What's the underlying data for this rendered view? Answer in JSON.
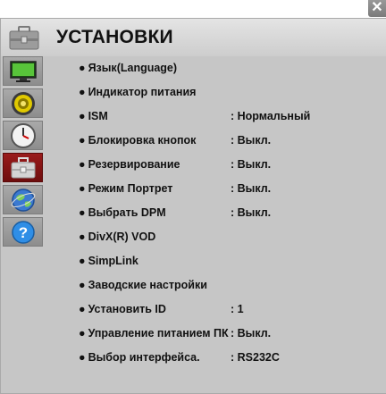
{
  "header": {
    "title": "УСТАНОВКИ",
    "close_label": "✕"
  },
  "bullet": "●",
  "items": [
    {
      "label": "Язык(Language)",
      "value": ""
    },
    {
      "label": "Индикатор питания",
      "value": ""
    },
    {
      "label": "ISM",
      "value": ": Нормальный"
    },
    {
      "label": "Блокировка кнопок",
      "value": ": Выкл."
    },
    {
      "label": "Резервирование",
      "value": ": Выкл."
    },
    {
      "label": "Режим Портрет",
      "value": ": Выкл."
    },
    {
      "label": "Выбрать DPM",
      "value": ": Выкл."
    },
    {
      "label": "DivX(R) VOD",
      "value": ""
    },
    {
      "label": "SimpLink",
      "value": ""
    },
    {
      "label": "Заводские настройки",
      "value": ""
    },
    {
      "label": "Установить ID",
      "value": ": 1"
    },
    {
      "label": "Управление питанием ПК",
      "value": ": Выкл."
    },
    {
      "label": "Выбор интерфейса.",
      "value": ": RS232C"
    }
  ],
  "sidebar": [
    "picture-icon",
    "audio-icon",
    "clock-icon",
    "settings-toolbox-icon",
    "network-globe-icon",
    "help-icon"
  ],
  "colors": {
    "active_tab": "#8a1515",
    "background": "#c6c6c6"
  }
}
